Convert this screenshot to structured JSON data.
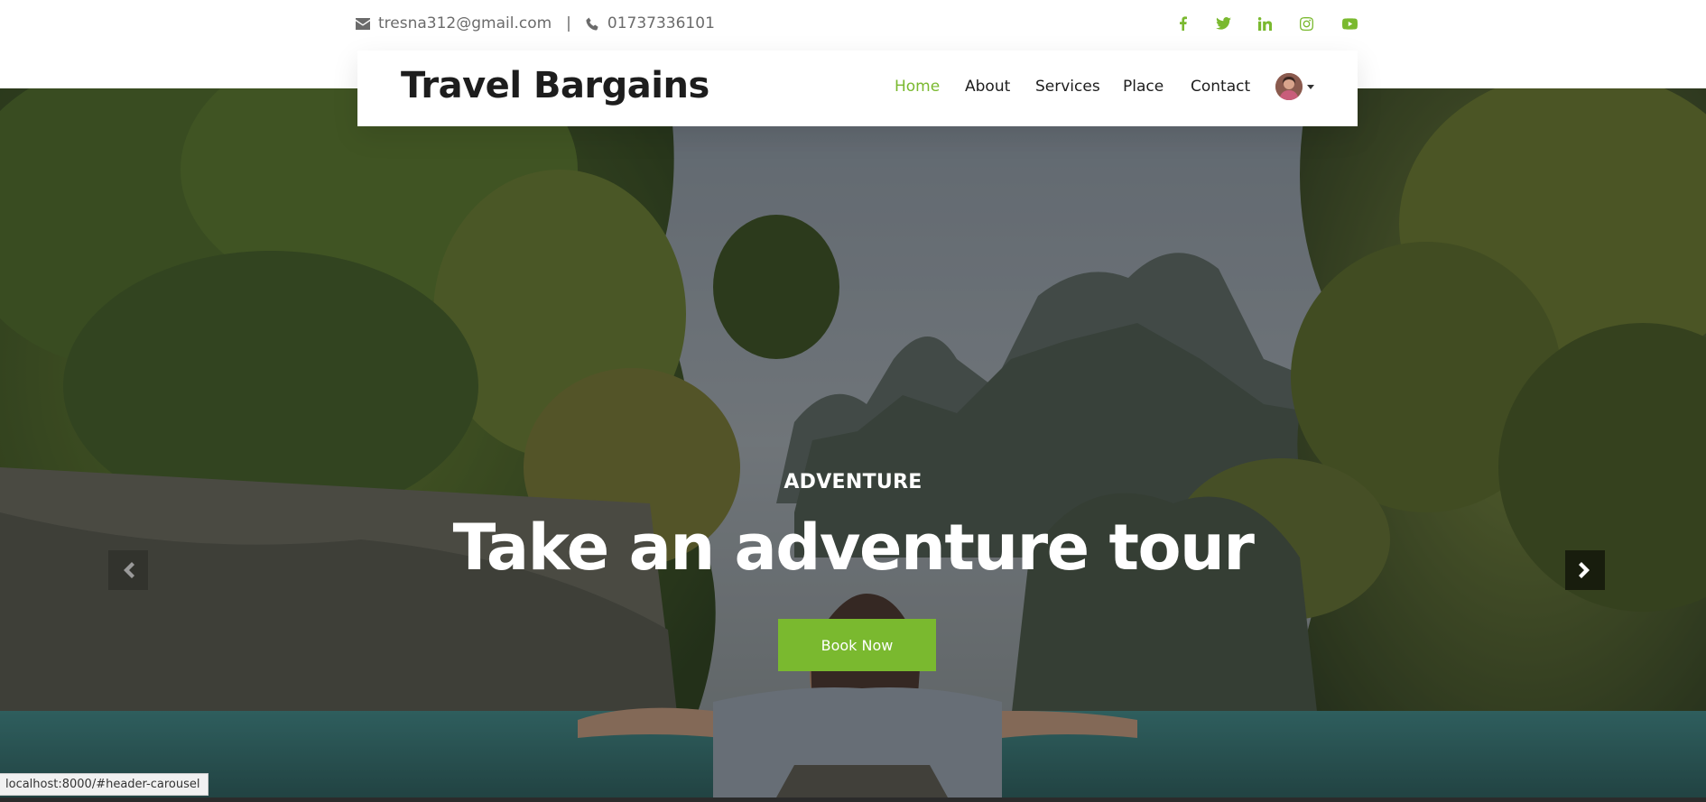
{
  "topbar": {
    "email": "tresna312@gmail.com",
    "separator": "|",
    "phone": "01737336101",
    "socials": [
      {
        "icon": "facebook-icon",
        "color": "#7ab92f"
      },
      {
        "icon": "twitter-icon",
        "color": "#7ab92f"
      },
      {
        "icon": "linkedin-icon",
        "color": "#7ab92f"
      },
      {
        "icon": "instagram-icon",
        "color": "#7ab92f"
      },
      {
        "icon": "youtube-icon",
        "color": "#7ab92f"
      }
    ]
  },
  "navbar": {
    "brand": "Travel Bargains",
    "items": [
      {
        "label": "Home",
        "active": true
      },
      {
        "label": "About",
        "active": false
      },
      {
        "label": "Services",
        "active": false
      },
      {
        "label": "Place",
        "active": false
      },
      {
        "label": "Contact",
        "active": false
      }
    ],
    "profile_icon": "avatar"
  },
  "hero": {
    "eyebrow": "ADVENTURE",
    "headline": "Take an adventure tour",
    "cta_label": "Book Now",
    "prev_icon": "chevron-left-icon",
    "next_icon": "chevron-right-icon"
  },
  "status_bar": {
    "url": "localhost:8000/#header-carousel"
  },
  "colors": {
    "accent": "#7ab92f",
    "text_dark": "#1d1d1d",
    "text_muted": "#6b6b6b"
  }
}
